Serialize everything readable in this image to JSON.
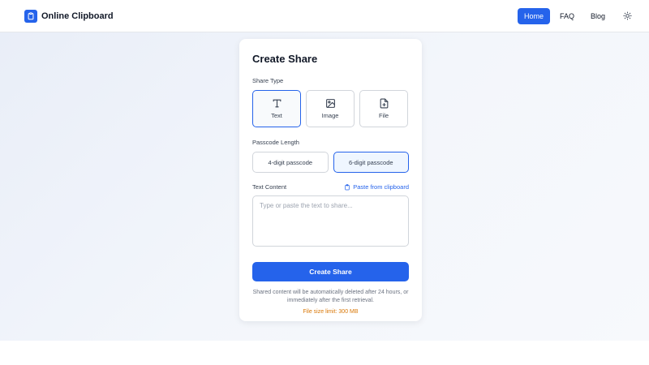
{
  "header": {
    "brand": {
      "title": "Online Clipboard",
      "icon": "clipboard-icon"
    },
    "nav": [
      {
        "label": "Home",
        "active": true
      },
      {
        "label": "FAQ",
        "active": false
      },
      {
        "label": "Blog",
        "active": false
      }
    ],
    "theme_toggle_icon": "sun-icon"
  },
  "card": {
    "title": "Create Share",
    "share_type": {
      "label": "Share Type",
      "options": [
        {
          "label": "Text",
          "icon": "text-icon",
          "selected": true
        },
        {
          "label": "Image",
          "icon": "image-icon",
          "selected": false
        },
        {
          "label": "File",
          "icon": "file-plus-icon",
          "selected": false
        }
      ]
    },
    "passcode": {
      "label": "Passcode Length",
      "options": [
        {
          "label": "4-digit passcode",
          "selected": false
        },
        {
          "label": "6-digit passcode",
          "selected": true
        }
      ]
    },
    "content": {
      "label": "Text Content",
      "paste_label": "Paste from clipboard",
      "value": "",
      "placeholder": "Type or paste the text to share..."
    },
    "submit_label": "Create Share",
    "note": "Shared content will be automatically deleted after 24 hours, or immediately after the first retrieval.",
    "limit_note": "File size limit: 300 MB"
  },
  "colors": {
    "accent": "#2563eb",
    "warning": "#d97706"
  }
}
